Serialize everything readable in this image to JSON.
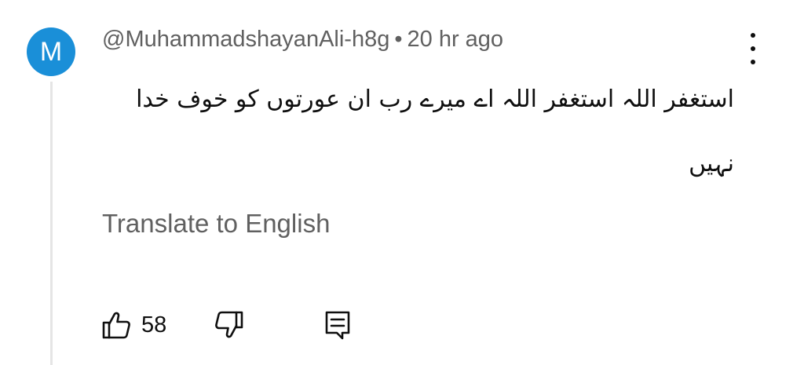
{
  "comment": {
    "avatar_letter": "M",
    "author": "@MuhammadshayanAli-h8g",
    "separator": "•",
    "time": "20 hr ago",
    "text": "استغفر اللہ استغفر اللہ اے میرے رب ان عورتوں کو خوف خدا نہیں",
    "translate_label": "Translate to English",
    "like_count": "58"
  },
  "icons": {
    "menu": "vertical-dots-icon",
    "like": "thumbs-up-icon",
    "dislike": "thumbs-down-icon",
    "reply": "reply-comment-icon"
  },
  "colors": {
    "avatar_bg": "#1a8fd8",
    "secondary_text": "#606060",
    "primary_text": "#0f0f0f"
  }
}
